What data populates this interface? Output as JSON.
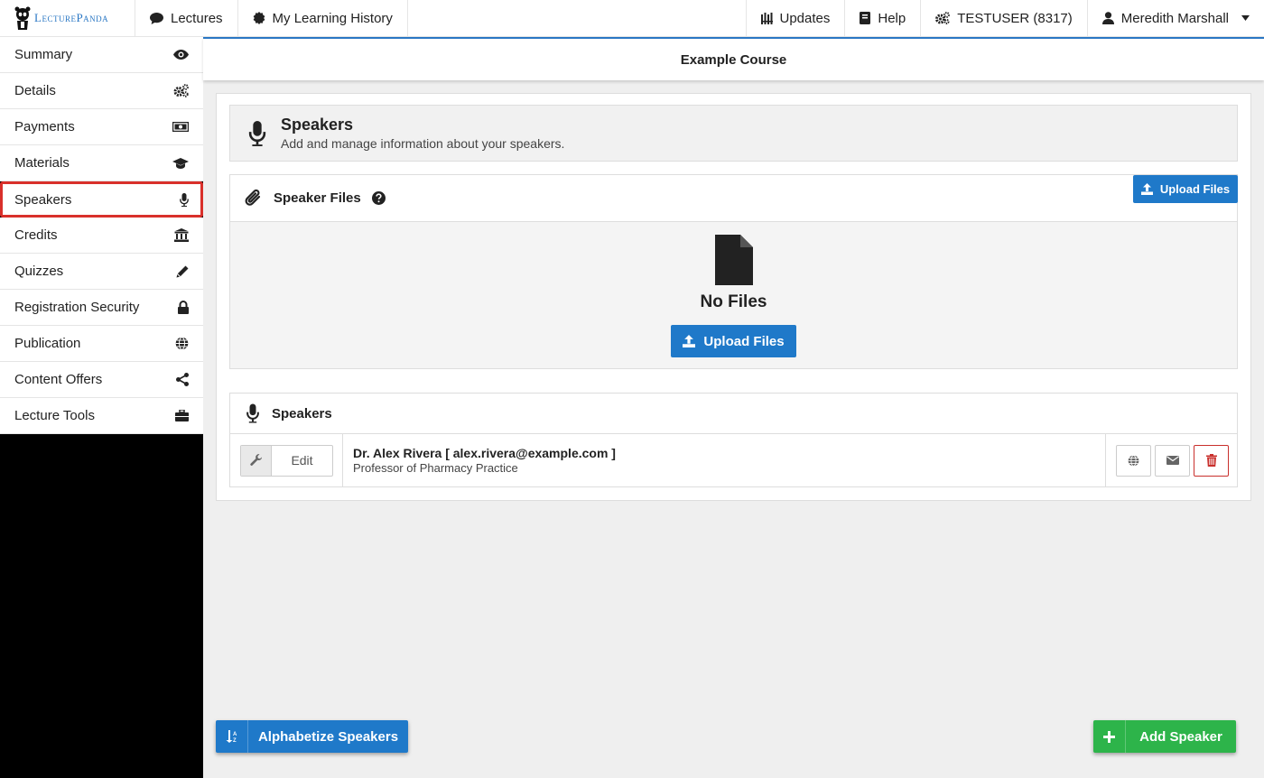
{
  "brand": {
    "logo_text": "LecturePanda"
  },
  "topnav": {
    "lectures": "Lectures",
    "history": "My Learning History",
    "updates": "Updates",
    "help": "Help",
    "account": "TESTUSER (8317)",
    "user": "Meredith Marshall"
  },
  "sidebar": {
    "items": [
      {
        "label": "Summary",
        "icon": "eye-icon"
      },
      {
        "label": "Details",
        "icon": "gears-icon"
      },
      {
        "label": "Payments",
        "icon": "money-icon"
      },
      {
        "label": "Materials",
        "icon": "graduation-cap-icon"
      },
      {
        "label": "Speakers",
        "icon": "microphone-icon",
        "active": true
      },
      {
        "label": "Credits",
        "icon": "institution-icon"
      },
      {
        "label": "Quizzes",
        "icon": "pencil-icon"
      },
      {
        "label": "Registration Security",
        "icon": "lock-icon"
      },
      {
        "label": "Publication",
        "icon": "globe-icon"
      },
      {
        "label": "Content Offers",
        "icon": "share-icon"
      },
      {
        "label": "Lecture Tools",
        "icon": "briefcase-icon"
      }
    ]
  },
  "course": {
    "title": "Example Course"
  },
  "header": {
    "title": "Speakers",
    "subtitle": "Add and manage information about your speakers."
  },
  "files": {
    "title": "Speaker Files",
    "upload_small": "Upload Files",
    "empty": "No Files",
    "upload_big": "Upload Files"
  },
  "speakers": {
    "title": "Speakers",
    "edit_label": "Edit",
    "list": [
      {
        "name_line": "Dr. Alex Rivera [ alex.rivera@example.com ]",
        "title": "Professor of Pharmacy Practice"
      }
    ]
  },
  "footer": {
    "alphabetize": "Alphabetize Speakers",
    "add": "Add Speaker"
  },
  "colors": {
    "primary": "#1f79c9",
    "success": "#2db44a",
    "danger": "#c9302c",
    "active_outline": "#d9302b"
  }
}
